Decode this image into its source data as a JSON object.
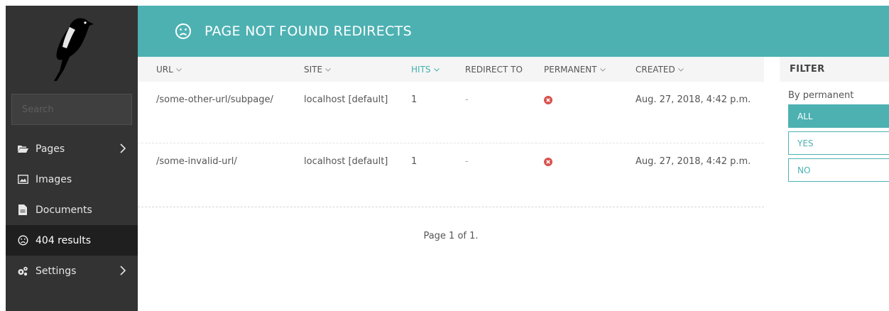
{
  "sidebar": {
    "search_placeholder": "Search",
    "items": [
      {
        "label": "Pages"
      },
      {
        "label": "Images"
      },
      {
        "label": "Documents"
      },
      {
        "label": "404 results"
      },
      {
        "label": "Settings"
      }
    ]
  },
  "header": {
    "title": "PAGE NOT FOUND REDIRECTS"
  },
  "table": {
    "columns": [
      "URL",
      "SITE",
      "HITS",
      "REDIRECT TO",
      "PERMANENT",
      "CREATED"
    ],
    "sorted_column": "HITS",
    "rows": [
      {
        "url": "/some-other-url/subpage/",
        "site": "localhost [default]",
        "hits": "1",
        "redirect_to": "-",
        "permanent": "no",
        "created": "Aug. 27, 2018, 4:42 p.m."
      },
      {
        "url": "/some-invalid-url/",
        "site": "localhost [default]",
        "hits": "1",
        "redirect_to": "-",
        "permanent": "no",
        "created": "Aug. 27, 2018, 4:42 p.m."
      }
    ]
  },
  "pager": {
    "text": "Page 1 of 1."
  },
  "filter": {
    "title": "FILTER",
    "label": "By permanent",
    "options": [
      "ALL",
      "YES",
      "NO"
    ],
    "selected": "ALL"
  },
  "colors": {
    "accent": "#4db1b2",
    "sidebar": "#333333",
    "error": "#d9534f"
  }
}
